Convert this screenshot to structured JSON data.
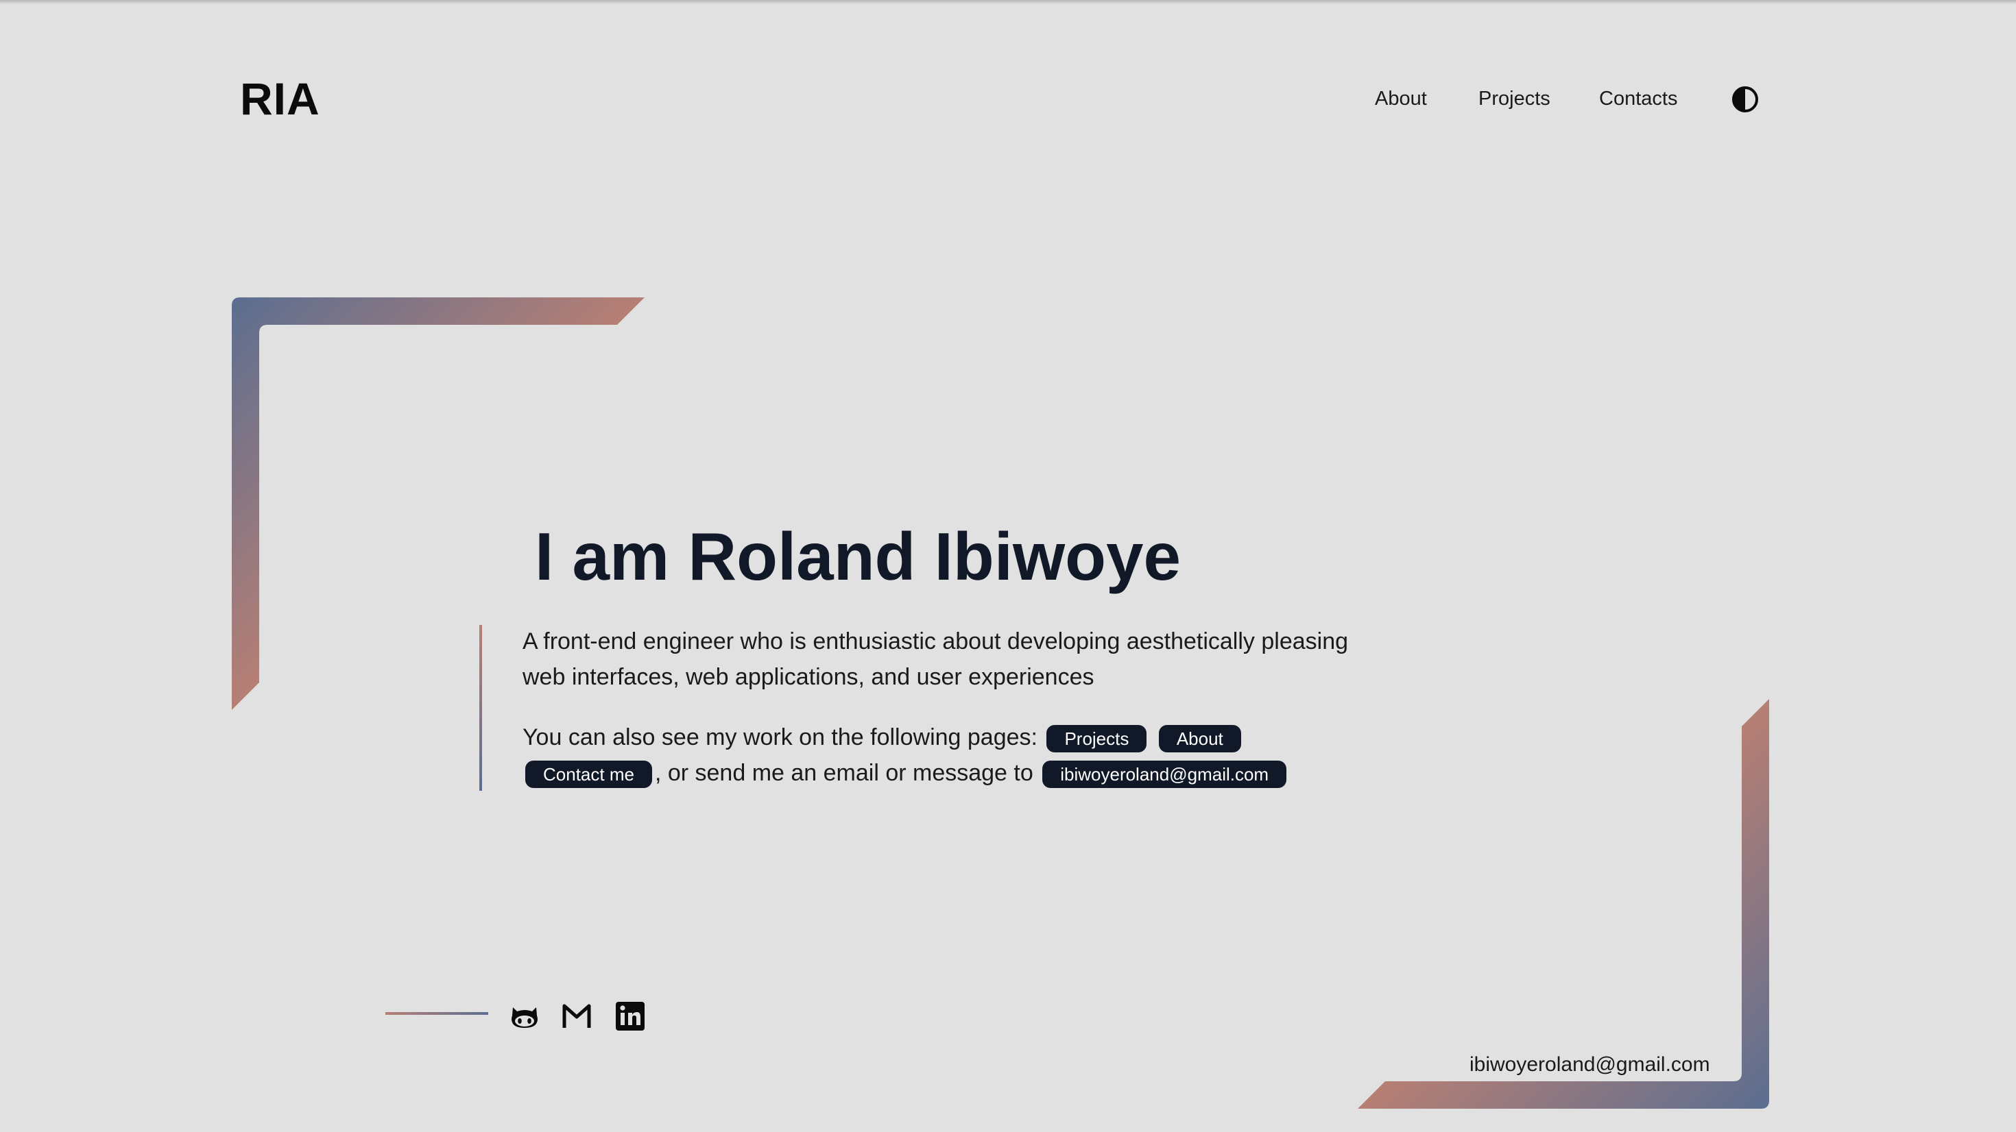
{
  "header": {
    "logo": "RIA",
    "nav": [
      {
        "label": "About"
      },
      {
        "label": "Projects"
      },
      {
        "label": "Contacts"
      }
    ],
    "theme_toggle_icon": "contrast-icon"
  },
  "hero": {
    "title": "I am Roland Ibiwoye",
    "intro": "A front-end engineer who is enthusiastic about developing aesthetically pleasing web interfaces, web applications, and user experiences",
    "pages_text": "You can also see my work on the following pages:",
    "pill_projects": "Projects",
    "pill_about": "About",
    "pill_contact": "Contact me",
    "email_text": ", or send me an email or message to",
    "pill_email": "ibiwoyeroland@gmail.com"
  },
  "social": {
    "icons": [
      "github-icon",
      "gmail-icon",
      "linkedin-icon"
    ]
  },
  "footer": {
    "email": "ibiwoyeroland@gmail.com"
  },
  "colors": {
    "background": "#e1e1e1",
    "accent_blue": "#5b6e91",
    "accent_rose": "#b77f74",
    "pill": "#111827"
  }
}
